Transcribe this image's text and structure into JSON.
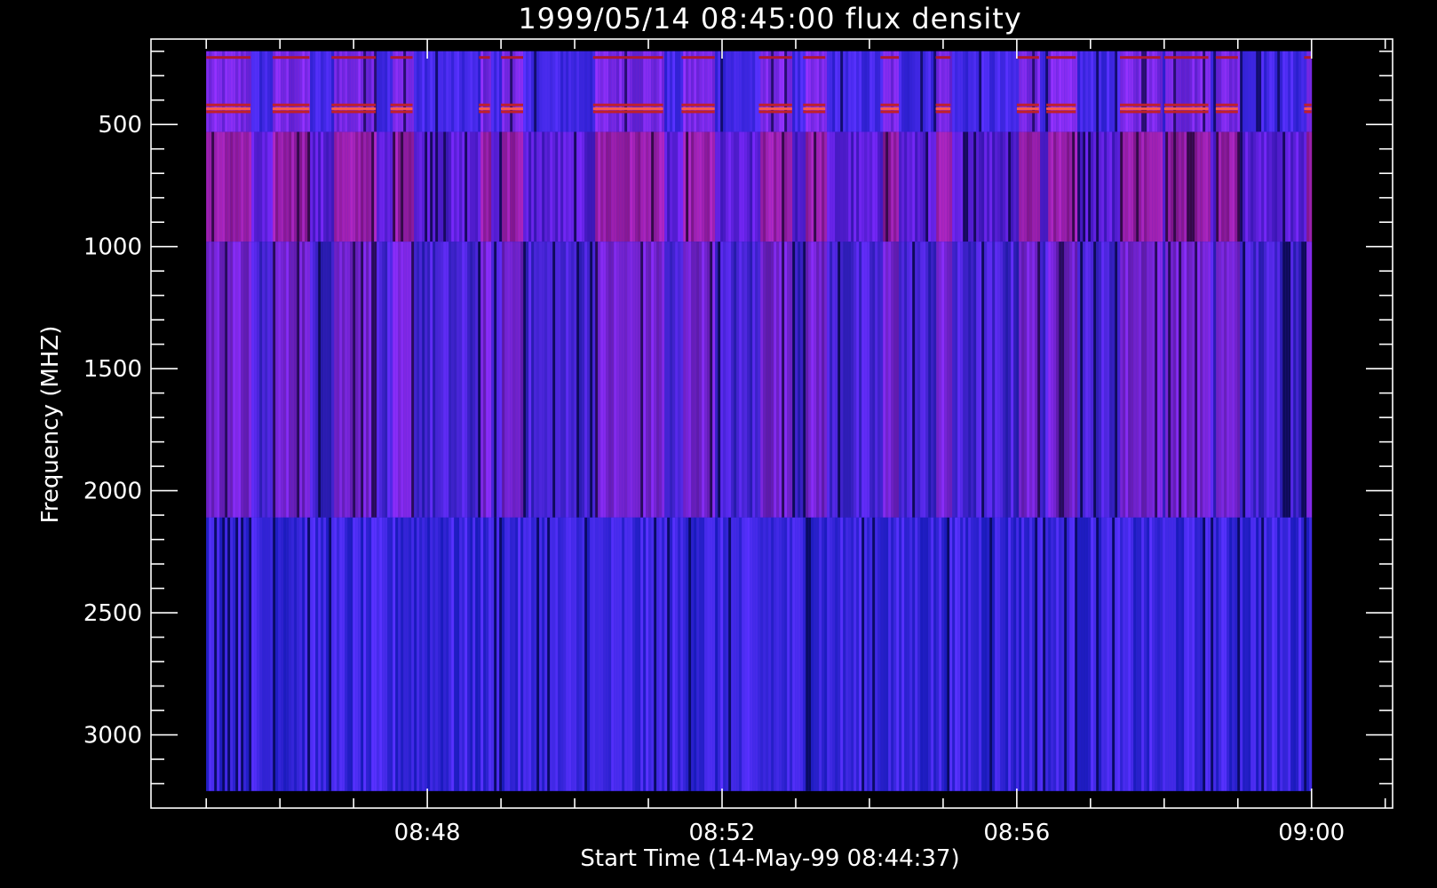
{
  "colors": {
    "background": "#000000",
    "axes": "#ffffff",
    "colormap_low": "#0a0a6e",
    "colormap_mid": "#2b1ee8",
    "colormap_high": "#c0101a"
  },
  "chart_data": {
    "type": "heatmap",
    "title": "1999/05/14 08:45:00 flux density",
    "xlabel": "Start Time (14-May-99 08:44:37)",
    "ylabel": "Frequency (MHZ)",
    "x_ticks": [
      "08:48",
      "08:52",
      "08:56",
      "09:00"
    ],
    "x_tick_values_minutes_after_0800": [
      48,
      52,
      56,
      60
    ],
    "y_ticks": [
      "500",
      "1000",
      "1500",
      "2000",
      "2500",
      "3000"
    ],
    "y_tick_values": [
      500,
      1000,
      1500,
      2000,
      2500,
      3000
    ],
    "xlim_minutes_after_0800": [
      44.25,
      61.1
    ],
    "ylim_mhz": [
      3300,
      150
    ],
    "data_time_range_minutes_after_0800": [
      45.0,
      60.0
    ],
    "data_frequency_range_mhz": [
      200,
      3230
    ],
    "y_inverted": true,
    "frequency_bands_mhz": [
      {
        "from": 200,
        "to": 530,
        "character": "noisy, interference rows near 430-450 MHz"
      },
      {
        "from": 530,
        "to": 980,
        "character": "vertical striations, red-purple"
      },
      {
        "from": 980,
        "to": 2110,
        "character": "vertical striations, blue-purple"
      },
      {
        "from": 2110,
        "to": 3230,
        "character": "vertical striations, blue"
      }
    ],
    "enhanced_intervals_minutes_after_0800": [
      [
        45.0,
        45.6
      ],
      [
        45.9,
        46.4
      ],
      [
        46.7,
        47.3
      ],
      [
        47.5,
        47.8
      ],
      [
        48.7,
        48.85
      ],
      [
        49.0,
        49.3
      ],
      [
        50.25,
        51.2
      ],
      [
        51.45,
        51.9
      ],
      [
        52.5,
        52.95
      ],
      [
        53.1,
        53.4
      ],
      [
        54.15,
        54.4
      ],
      [
        54.9,
        55.1
      ],
      [
        56.0,
        56.3
      ],
      [
        56.4,
        56.8
      ],
      [
        57.4,
        57.95
      ],
      [
        58.0,
        58.6
      ],
      [
        58.7,
        59.0
      ],
      [
        59.9,
        60.0
      ]
    ],
    "grid": false,
    "legend": "none"
  }
}
